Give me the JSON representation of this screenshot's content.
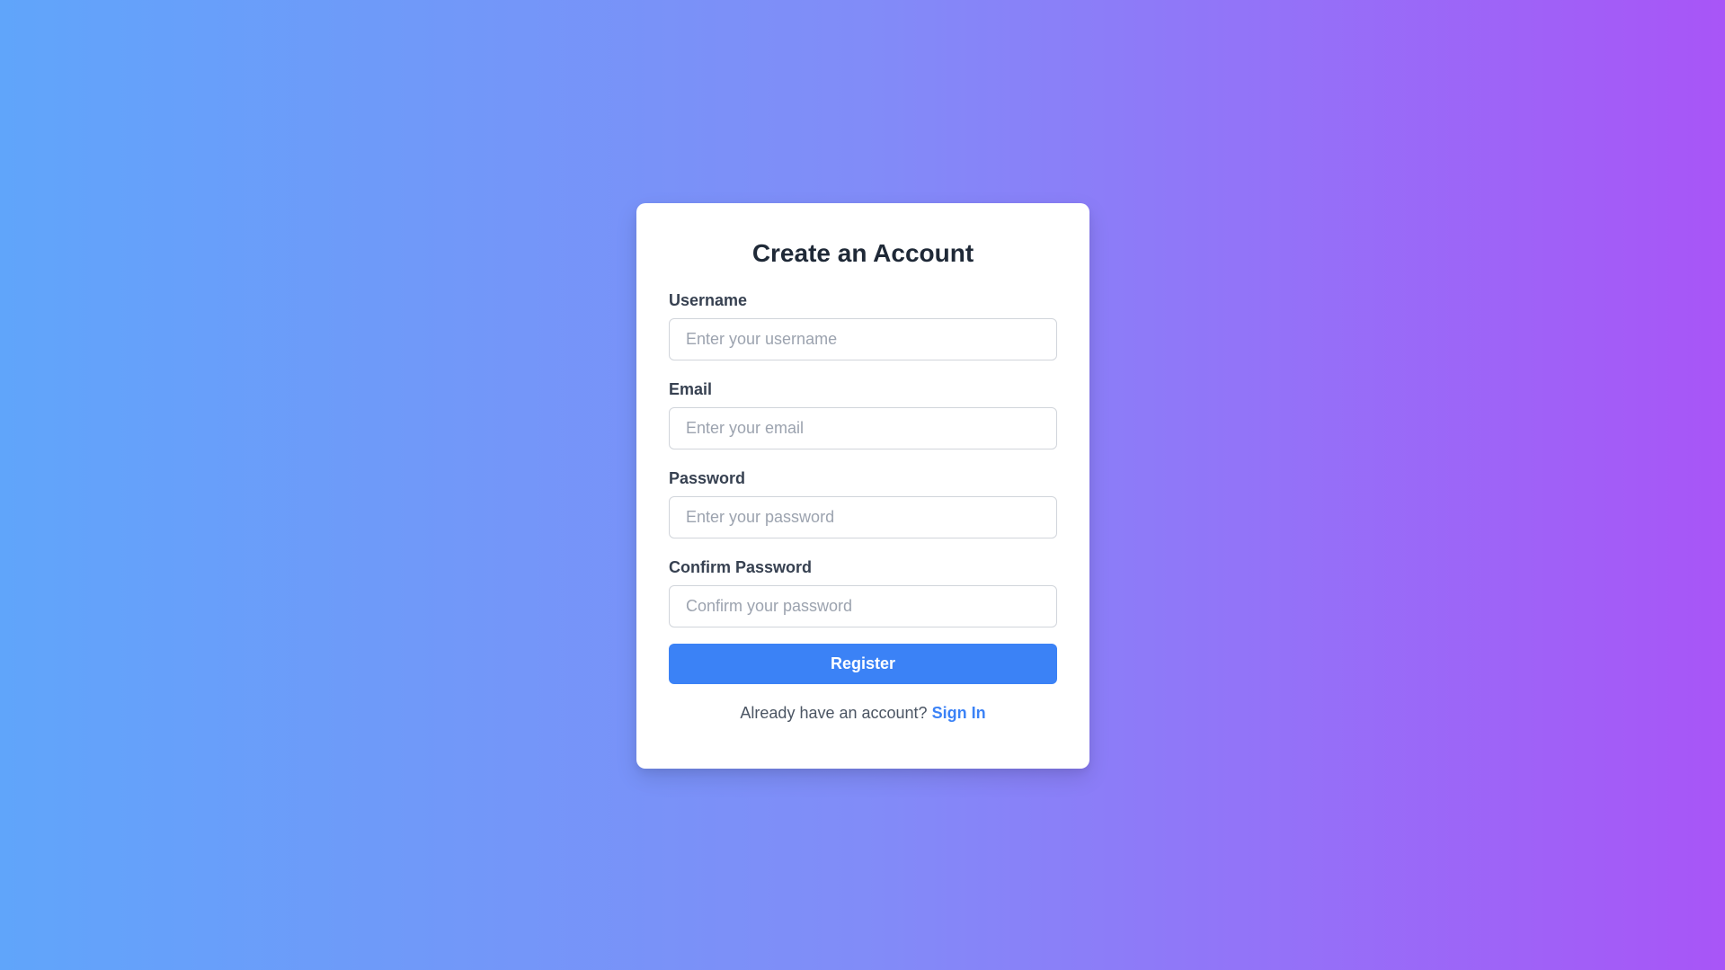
{
  "form": {
    "title": "Create an Account",
    "fields": [
      {
        "label": "Username",
        "placeholder": "Enter your username",
        "value": ""
      },
      {
        "label": "Email",
        "placeholder": "Enter your email",
        "value": ""
      },
      {
        "label": "Password",
        "placeholder": "Enter your password",
        "value": ""
      },
      {
        "label": "Confirm Password",
        "placeholder": "Confirm your password",
        "value": ""
      }
    ],
    "submit_label": "Register",
    "footer_text": "Already have an account?",
    "footer_link": "Sign In"
  },
  "colors": {
    "gradient_start": "#60a5fa",
    "gradient_end": "#a855f7",
    "accent": "#3b82f6"
  }
}
